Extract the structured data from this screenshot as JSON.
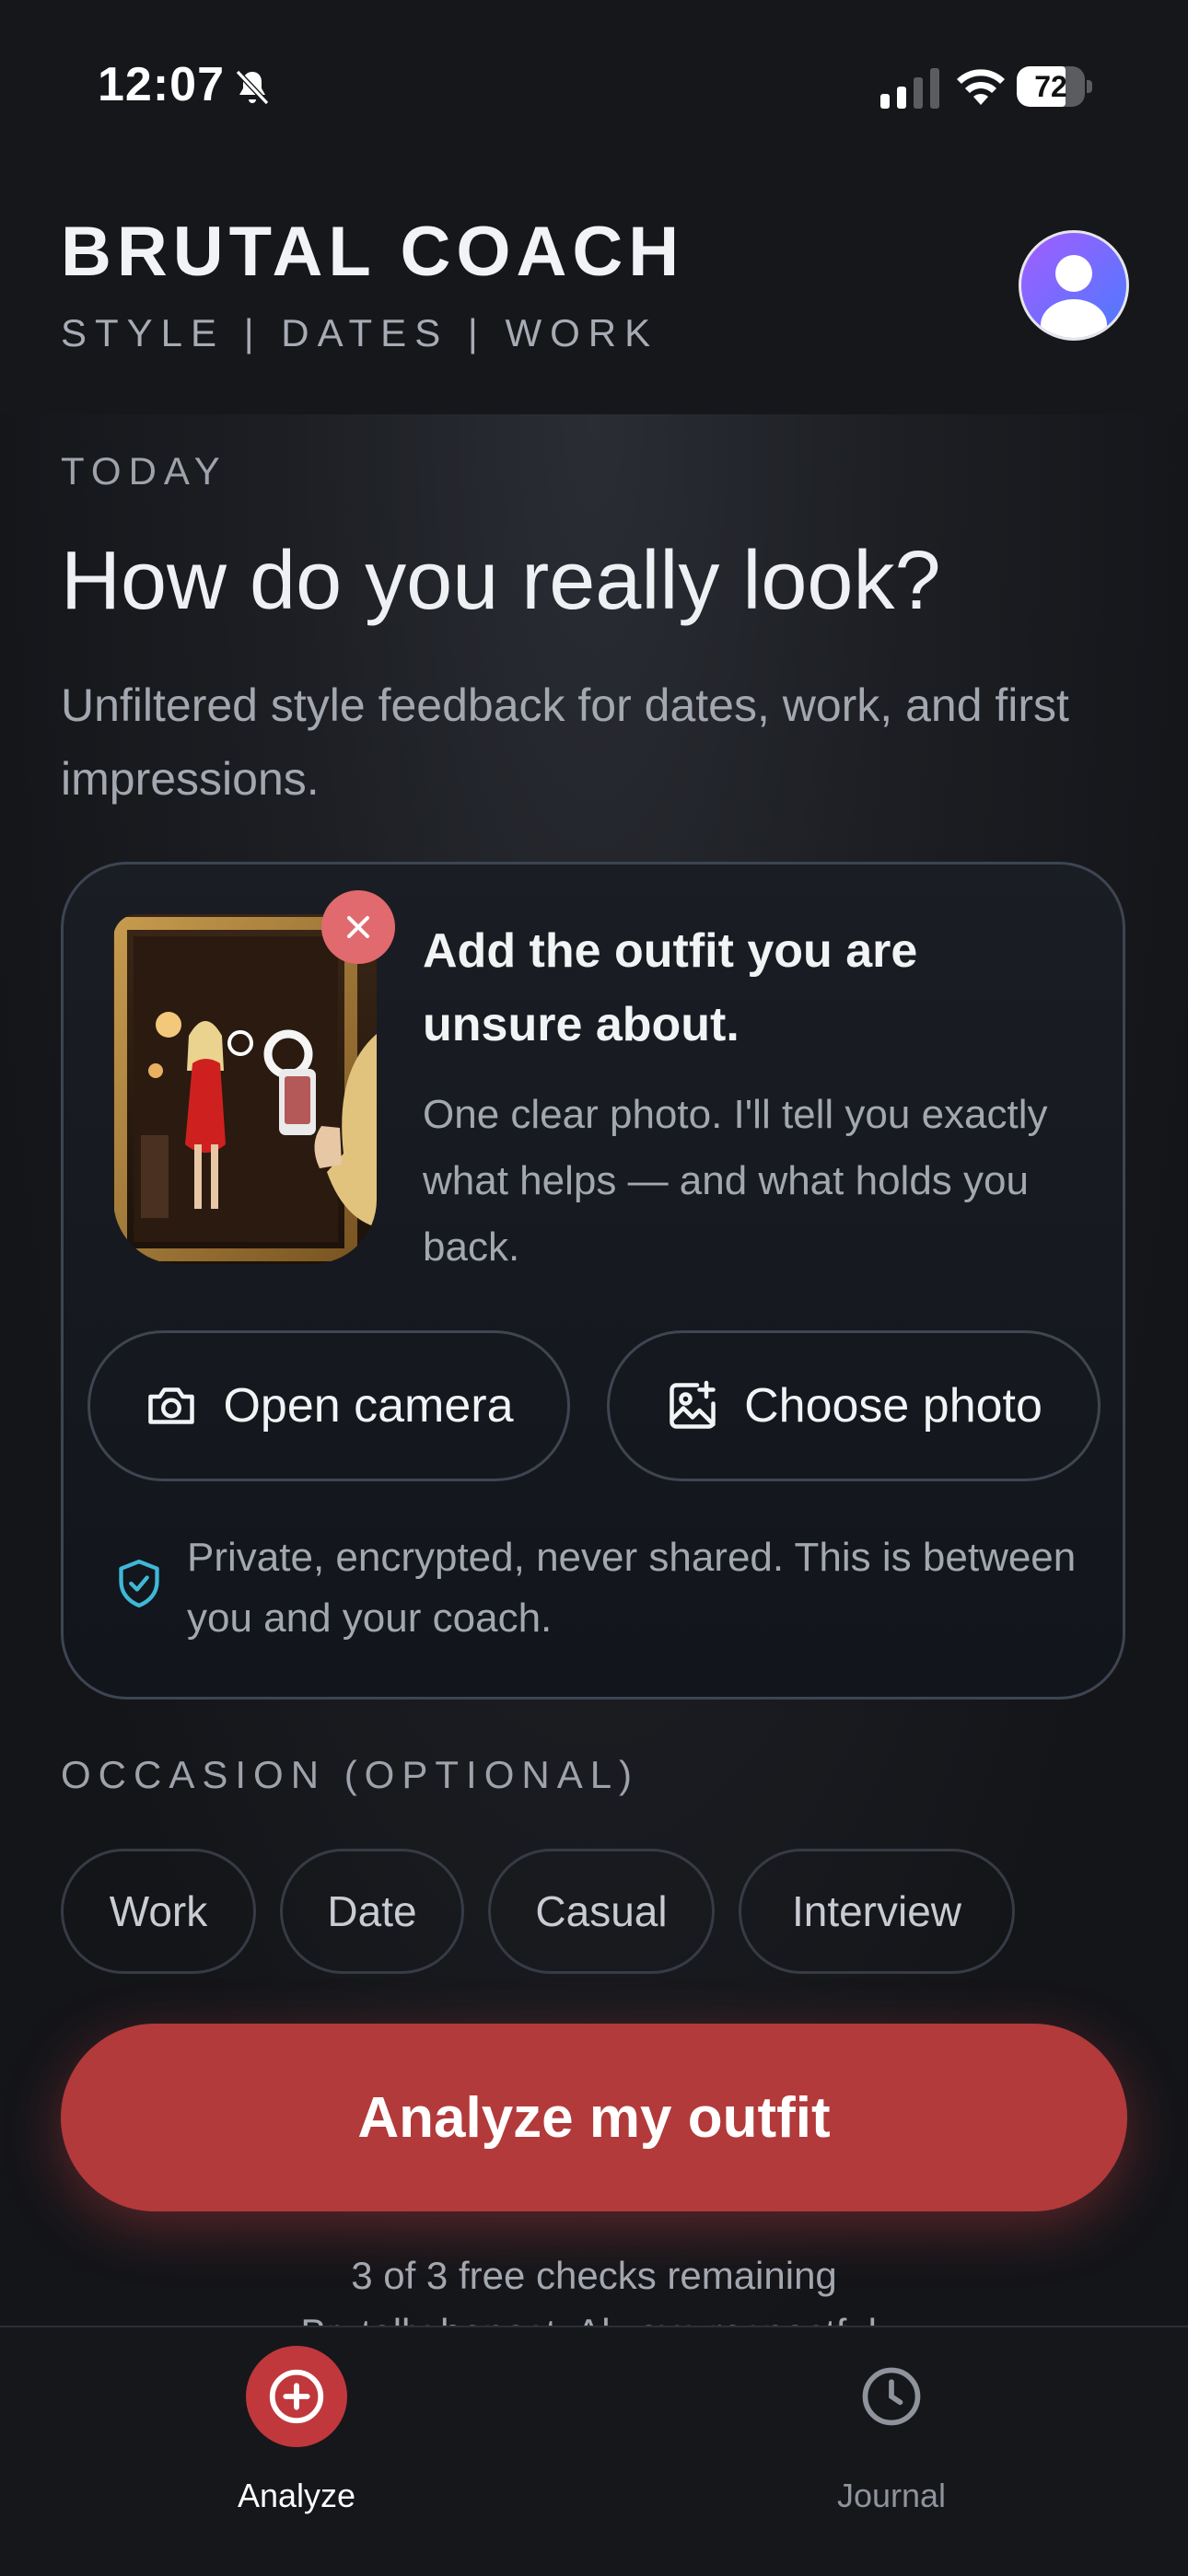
{
  "status_bar": {
    "time": "12:07",
    "battery": "72",
    "battery_level": 0.72
  },
  "header": {
    "title": "BRUTAL COACH",
    "tagline": "STYLE | DATES | WORK"
  },
  "main": {
    "section_label": "TODAY",
    "headline": "How do you really look?",
    "subtitle": "Unfiltered style feedback for dates, work, and first impressions."
  },
  "upload_card": {
    "title": "Add the outfit you are unsure about.",
    "description": "One clear photo. I'll tell you exactly what helps — and what holds you back.",
    "camera_button": "Open camera",
    "choose_button": "Choose photo",
    "privacy_note": "Private, encrypted, never shared. This is between you and your coach."
  },
  "occasion": {
    "label": "OCCASION (OPTIONAL)",
    "options": [
      "Work",
      "Date",
      "Casual",
      "Interview"
    ]
  },
  "cta": {
    "label": "Analyze my outfit",
    "remaining": "3 of 3 free checks remaining",
    "footnote": "Brutally honest. Always respectful."
  },
  "tabbar": {
    "analyze_label": "Analyze",
    "journal_label": "Journal"
  },
  "colors": {
    "accent": "#b23a3b",
    "tab_active": "#c0383c",
    "shield": "#3fb8d8"
  }
}
